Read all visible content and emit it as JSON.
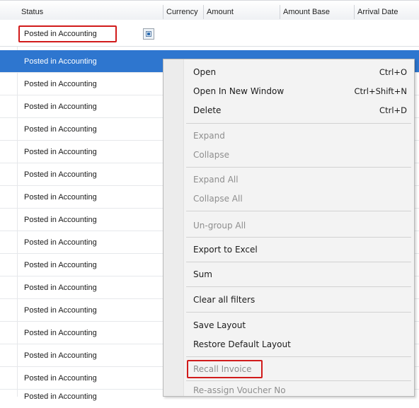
{
  "grid": {
    "columns": [
      "Status",
      "Currency",
      "Amount",
      "Amount Base",
      "Arrival Date"
    ],
    "filter_value": "Posted in Accounting",
    "rows": [
      "Posted in Accounting",
      "Posted in Accounting",
      "Posted in Accounting",
      "Posted in Accounting",
      "Posted in Accounting",
      "Posted in Accounting",
      "Posted in Accounting",
      "Posted in Accounting",
      "Posted in Accounting",
      "Posted in Accounting",
      "Posted in Accounting",
      "Posted in Accounting",
      "Posted in Accounting",
      "Posted in Accounting",
      "Posted in Accounting",
      "Posted in Accounting"
    ],
    "selected_row_index": 0
  },
  "context_menu": {
    "open": {
      "label": "Open",
      "shortcut": "Ctrl+O"
    },
    "open_new_window": {
      "label": "Open In New Window",
      "shortcut": "Ctrl+Shift+N"
    },
    "delete": {
      "label": "Delete",
      "shortcut": "Ctrl+D"
    },
    "expand": {
      "label": "Expand"
    },
    "collapse": {
      "label": "Collapse"
    },
    "expand_all": {
      "label": "Expand All"
    },
    "collapse_all": {
      "label": "Collapse All"
    },
    "ungroup_all": {
      "label": "Un-group All"
    },
    "export_excel": {
      "label": "Export to Excel"
    },
    "sum": {
      "label": "Sum"
    },
    "clear_filters": {
      "label": "Clear all filters"
    },
    "save_layout": {
      "label": "Save Layout"
    },
    "restore_layout": {
      "label": "Restore Default Layout"
    },
    "recall_invoice": {
      "label": "Recall Invoice"
    },
    "reassign_voucher": {
      "label": "Re-assign Voucher No"
    }
  },
  "colors": {
    "selection": "#2e76cf",
    "highlight_border": "#d11b1b"
  }
}
